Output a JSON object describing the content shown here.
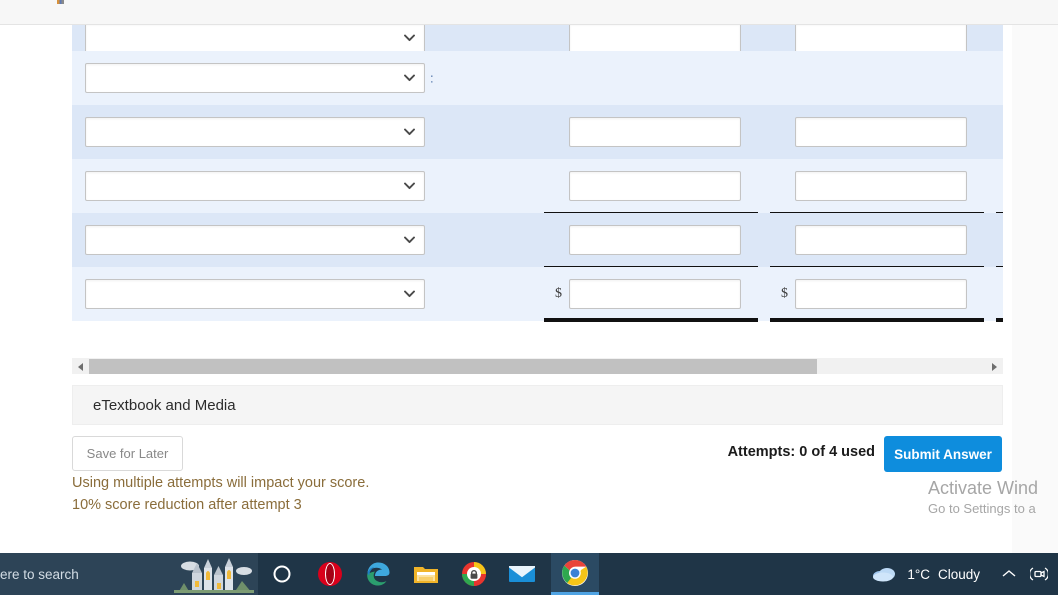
{
  "browser": {
    "chrome_strip": "top-chrome-sliver"
  },
  "question_table": {
    "scroll_position_percent": 0,
    "rows": [
      {
        "id": "row-1",
        "shade": "even",
        "clipped": true,
        "select_value": "",
        "colon": "",
        "inputs": [
          {
            "prefix": "",
            "value": ""
          },
          {
            "prefix": "",
            "value": ""
          },
          {
            "prefix": "",
            "value": ""
          }
        ],
        "rule_top": "none",
        "rule_bottom": "none"
      },
      {
        "id": "row-2",
        "shade": "odd",
        "clipped": false,
        "select_value": "",
        "colon": ":",
        "inputs": [],
        "rule_top": "none",
        "rule_bottom": "none"
      },
      {
        "id": "row-3",
        "shade": "even",
        "clipped": false,
        "select_value": "",
        "colon": "",
        "inputs": [
          {
            "prefix": "",
            "value": ""
          },
          {
            "prefix": "",
            "value": ""
          },
          {
            "prefix": "",
            "value": ""
          }
        ],
        "rule_top": "none",
        "rule_bottom": "none"
      },
      {
        "id": "row-4",
        "shade": "odd",
        "clipped": false,
        "select_value": "",
        "colon": "",
        "inputs": [
          {
            "prefix": "",
            "value": ""
          },
          {
            "prefix": "",
            "value": ""
          },
          {
            "prefix": "",
            "value": ""
          }
        ],
        "rule_top": "none",
        "rule_bottom": "single"
      },
      {
        "id": "row-5",
        "shade": "even",
        "clipped": false,
        "select_value": "",
        "colon": "",
        "inputs": [
          {
            "prefix": "",
            "value": ""
          },
          {
            "prefix": "",
            "value": ""
          },
          {
            "prefix": "",
            "value": ""
          }
        ],
        "rule_top": "none",
        "rule_bottom": "single"
      },
      {
        "id": "row-6",
        "shade": "odd",
        "clipped": false,
        "select_value": "",
        "colon": "",
        "inputs": [
          {
            "prefix": "$",
            "value": ""
          },
          {
            "prefix": "$",
            "value": ""
          },
          {
            "prefix": "$",
            "value": ""
          }
        ],
        "rule_top": "none",
        "rule_bottom": "double"
      }
    ]
  },
  "etextbook": {
    "label": "eTextbook and Media"
  },
  "footer": {
    "save_for_later_label": "Save for Later",
    "attempts_text": "Attempts: 0 of 4 used",
    "submit_label": "Submit Answer",
    "warning_line_1": "Using multiple attempts will impact your score.",
    "warning_line_2": "10% score reduction after attempt 3"
  },
  "watermark": {
    "title": "Activate Wind",
    "subtitle": "Go to Settings to a"
  },
  "taskbar": {
    "search_placeholder": "ere to search",
    "icons": [
      {
        "name": "cortana-icon",
        "label": "Cortana"
      },
      {
        "name": "opera-icon",
        "label": "Opera"
      },
      {
        "name": "edge-icon",
        "label": "Microsoft Edge"
      },
      {
        "name": "file-explorer-icon",
        "label": "File Explorer"
      },
      {
        "name": "password-manager-icon",
        "label": "Password Manager"
      },
      {
        "name": "mail-icon",
        "label": "Mail"
      },
      {
        "name": "chrome-icon",
        "label": "Google Chrome"
      }
    ],
    "weather": {
      "temperature": "1°C",
      "condition": "Cloudy"
    },
    "tray": {
      "show_hidden_label": "^",
      "meet_now_label": "Meet Now"
    }
  },
  "colors": {
    "row_light": "#ebf2fc",
    "row_dark": "#dce7f7",
    "submit_blue": "#0e8ddd",
    "warning_brown": "#8a6d3b",
    "taskbar_bg": "#1f3547",
    "scrollbar_thumb": "#c1c1c1"
  }
}
